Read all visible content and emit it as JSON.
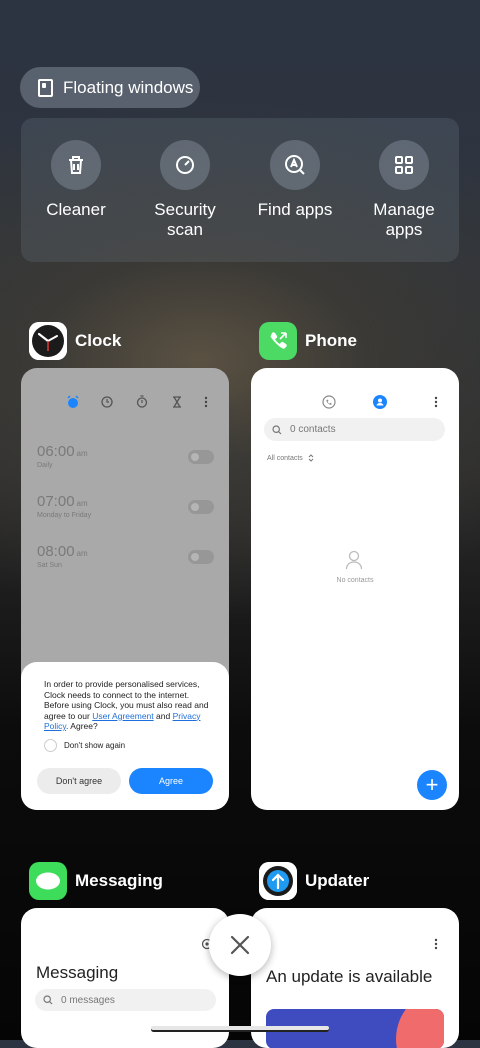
{
  "floating_windows": {
    "label": "Floating windows",
    "icon": "floating-window-icon"
  },
  "tools": [
    {
      "label": "Cleaner",
      "icon": "trash-icon"
    },
    {
      "label": "Security scan",
      "icon": "security-scan-icon"
    },
    {
      "label": "Find apps",
      "icon": "find-apps-icon"
    },
    {
      "label": "Manage apps",
      "icon": "manage-apps-icon"
    }
  ],
  "cards": {
    "clock": {
      "title": "Clock",
      "alarms": [
        {
          "time": "06:00",
          "ampm": "am",
          "repeat": "Daily"
        },
        {
          "time": "07:00",
          "ampm": "am",
          "repeat": "Monday to Friday"
        },
        {
          "time": "08:00",
          "ampm": "am",
          "repeat": "Sat Sun"
        }
      ],
      "dialog": {
        "text": "In order to provide personalised services, Clock needs to connect to the internet. Before using Clock, you must also read and agree to our",
        "link1": "User Agreement",
        "and": "and",
        "link2": "Privacy Policy",
        "tail": ". Agree?",
        "checkbox": "Don't show again",
        "disagree": "Don't agree",
        "agree": "Agree"
      }
    },
    "phone": {
      "title": "Phone",
      "search_placeholder": "0 contacts",
      "filter": "All contacts",
      "empty": "No contacts",
      "fab": "+"
    },
    "messaging": {
      "title": "Messaging",
      "heading": "Messaging",
      "search_placeholder": "0 messages"
    },
    "updater": {
      "title": "Updater",
      "heading": "An update is available"
    }
  },
  "colors": {
    "accent": "#1a85ff",
    "phone_icon": "#4cd964",
    "messaging_icon": "#3ddc5a"
  }
}
